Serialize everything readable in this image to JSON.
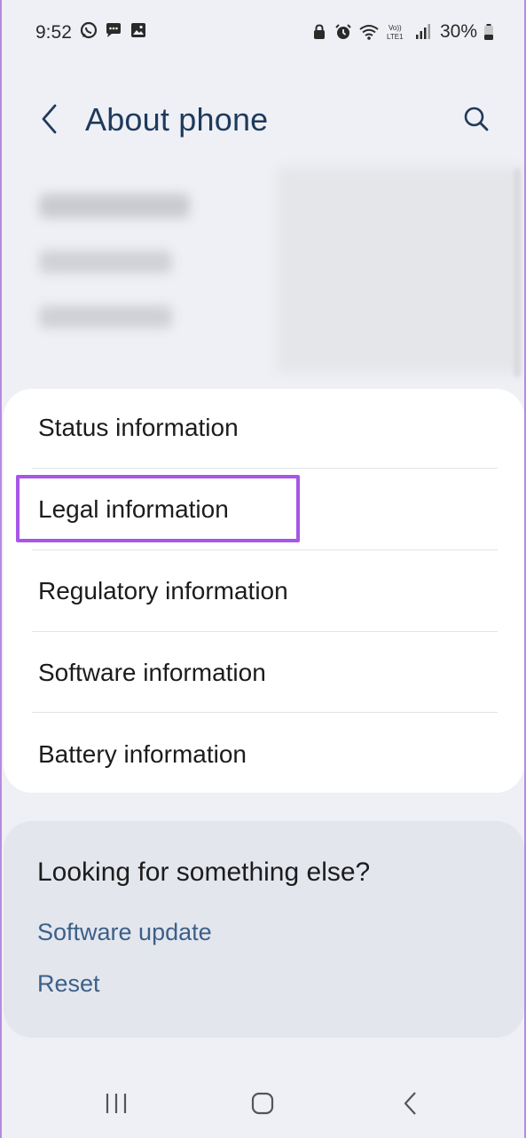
{
  "status_bar": {
    "time": "9:52",
    "battery": "30%",
    "left_icons": [
      "whatsapp-icon",
      "message-icon",
      "gallery-icon"
    ],
    "right_icons": [
      "lock-icon",
      "alarm-icon",
      "wifi-icon",
      "volte-icon",
      "signal-icon",
      "battery-icon"
    ]
  },
  "header": {
    "title": "About phone",
    "back_icon": "chevron-left-icon",
    "search_icon": "search-icon"
  },
  "info_items": [
    {
      "label": "Status information"
    },
    {
      "label": "Legal information",
      "highlighted": true
    },
    {
      "label": "Regulatory information"
    },
    {
      "label": "Software information"
    },
    {
      "label": "Battery information"
    }
  ],
  "suggestions": {
    "title": "Looking for something else?",
    "links": [
      "Software update",
      "Reset"
    ]
  },
  "nav_bar": {
    "buttons": [
      "recents-icon",
      "home-icon",
      "back-icon"
    ]
  },
  "colors": {
    "background": "#eef0f5",
    "title": "#1e3a5c",
    "link": "#3b6089",
    "highlight": "#a856e8"
  }
}
